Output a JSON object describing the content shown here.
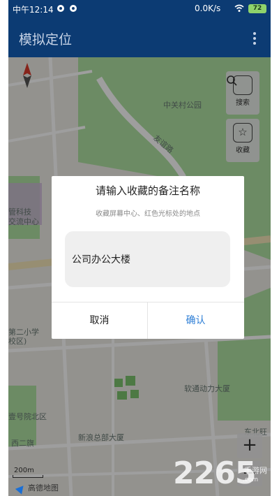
{
  "status_bar": {
    "time": "中午12:14",
    "net_speed": "0.0K/s",
    "battery": "72"
  },
  "app_bar": {
    "title": "模拟定位"
  },
  "map": {
    "labels": {
      "park": "中关村公园",
      "road": "友谊路",
      "poi_left_1": "管科技",
      "poi_left_2": "交流中心",
      "school_1": "第二小学",
      "school_2": "校区)",
      "building_1": "软通动力大厦",
      "building_2": "新浪总部大厦",
      "hospital": "壹号院北区",
      "bottom_left": "西二旗",
      "right_bottom": "东北旺"
    },
    "side_buttons": {
      "search": "搜索",
      "favorite": "收藏"
    },
    "zoom_in": "+",
    "zoom_out": "−",
    "scale": "200m",
    "provider": "高德地图"
  },
  "dialog": {
    "title": "请输入收藏的备注名称",
    "subtitle": "收藏屏幕中心、红色光标处的地点",
    "input_value": "公司办公大楼",
    "cancel": "取消",
    "confirm": "确认"
  },
  "watermark": {
    "logo": "2265",
    "site": "手游网",
    "domain": ".com"
  },
  "colors": {
    "app_bar": "#0c3b73",
    "confirm_text": "#2d7ed6",
    "map_green": "#aee0a2",
    "map_land": "#eeece6"
  }
}
